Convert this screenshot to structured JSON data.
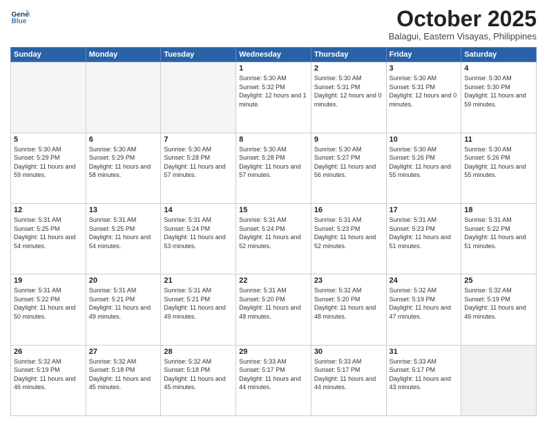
{
  "logo": {
    "line1": "General",
    "line2": "Blue"
  },
  "header": {
    "month": "October 2025",
    "location": "Balagui, Eastern Visayas, Philippines"
  },
  "weekdays": [
    "Sunday",
    "Monday",
    "Tuesday",
    "Wednesday",
    "Thursday",
    "Friday",
    "Saturday"
  ],
  "weeks": [
    [
      {
        "day": "",
        "sunrise": "",
        "sunset": "",
        "daylight": "",
        "empty": true
      },
      {
        "day": "",
        "sunrise": "",
        "sunset": "",
        "daylight": "",
        "empty": true
      },
      {
        "day": "",
        "sunrise": "",
        "sunset": "",
        "daylight": "",
        "empty": true
      },
      {
        "day": "1",
        "sunrise": "Sunrise: 5:30 AM",
        "sunset": "Sunset: 5:32 PM",
        "daylight": "Daylight: 12 hours and 1 minute."
      },
      {
        "day": "2",
        "sunrise": "Sunrise: 5:30 AM",
        "sunset": "Sunset: 5:31 PM",
        "daylight": "Daylight: 12 hours and 0 minutes."
      },
      {
        "day": "3",
        "sunrise": "Sunrise: 5:30 AM",
        "sunset": "Sunset: 5:31 PM",
        "daylight": "Daylight: 12 hours and 0 minutes."
      },
      {
        "day": "4",
        "sunrise": "Sunrise: 5:30 AM",
        "sunset": "Sunset: 5:30 PM",
        "daylight": "Daylight: 11 hours and 59 minutes."
      }
    ],
    [
      {
        "day": "5",
        "sunrise": "Sunrise: 5:30 AM",
        "sunset": "Sunset: 5:29 PM",
        "daylight": "Daylight: 11 hours and 59 minutes."
      },
      {
        "day": "6",
        "sunrise": "Sunrise: 5:30 AM",
        "sunset": "Sunset: 5:29 PM",
        "daylight": "Daylight: 11 hours and 58 minutes."
      },
      {
        "day": "7",
        "sunrise": "Sunrise: 5:30 AM",
        "sunset": "Sunset: 5:28 PM",
        "daylight": "Daylight: 11 hours and 57 minutes."
      },
      {
        "day": "8",
        "sunrise": "Sunrise: 5:30 AM",
        "sunset": "Sunset: 5:28 PM",
        "daylight": "Daylight: 11 hours and 57 minutes."
      },
      {
        "day": "9",
        "sunrise": "Sunrise: 5:30 AM",
        "sunset": "Sunset: 5:27 PM",
        "daylight": "Daylight: 11 hours and 56 minutes."
      },
      {
        "day": "10",
        "sunrise": "Sunrise: 5:30 AM",
        "sunset": "Sunset: 5:26 PM",
        "daylight": "Daylight: 11 hours and 55 minutes."
      },
      {
        "day": "11",
        "sunrise": "Sunrise: 5:30 AM",
        "sunset": "Sunset: 5:26 PM",
        "daylight": "Daylight: 11 hours and 55 minutes."
      }
    ],
    [
      {
        "day": "12",
        "sunrise": "Sunrise: 5:31 AM",
        "sunset": "Sunset: 5:25 PM",
        "daylight": "Daylight: 11 hours and 54 minutes."
      },
      {
        "day": "13",
        "sunrise": "Sunrise: 5:31 AM",
        "sunset": "Sunset: 5:25 PM",
        "daylight": "Daylight: 11 hours and 54 minutes."
      },
      {
        "day": "14",
        "sunrise": "Sunrise: 5:31 AM",
        "sunset": "Sunset: 5:24 PM",
        "daylight": "Daylight: 11 hours and 53 minutes."
      },
      {
        "day": "15",
        "sunrise": "Sunrise: 5:31 AM",
        "sunset": "Sunset: 5:24 PM",
        "daylight": "Daylight: 11 hours and 52 minutes."
      },
      {
        "day": "16",
        "sunrise": "Sunrise: 5:31 AM",
        "sunset": "Sunset: 5:23 PM",
        "daylight": "Daylight: 11 hours and 52 minutes."
      },
      {
        "day": "17",
        "sunrise": "Sunrise: 5:31 AM",
        "sunset": "Sunset: 5:23 PM",
        "daylight": "Daylight: 11 hours and 51 minutes."
      },
      {
        "day": "18",
        "sunrise": "Sunrise: 5:31 AM",
        "sunset": "Sunset: 5:22 PM",
        "daylight": "Daylight: 11 hours and 51 minutes."
      }
    ],
    [
      {
        "day": "19",
        "sunrise": "Sunrise: 5:31 AM",
        "sunset": "Sunset: 5:22 PM",
        "daylight": "Daylight: 11 hours and 50 minutes."
      },
      {
        "day": "20",
        "sunrise": "Sunrise: 5:31 AM",
        "sunset": "Sunset: 5:21 PM",
        "daylight": "Daylight: 11 hours and 49 minutes."
      },
      {
        "day": "21",
        "sunrise": "Sunrise: 5:31 AM",
        "sunset": "Sunset: 5:21 PM",
        "daylight": "Daylight: 11 hours and 49 minutes."
      },
      {
        "day": "22",
        "sunrise": "Sunrise: 5:31 AM",
        "sunset": "Sunset: 5:20 PM",
        "daylight": "Daylight: 11 hours and 48 minutes."
      },
      {
        "day": "23",
        "sunrise": "Sunrise: 5:32 AM",
        "sunset": "Sunset: 5:20 PM",
        "daylight": "Daylight: 11 hours and 48 minutes."
      },
      {
        "day": "24",
        "sunrise": "Sunrise: 5:32 AM",
        "sunset": "Sunset: 5:19 PM",
        "daylight": "Daylight: 11 hours and 47 minutes."
      },
      {
        "day": "25",
        "sunrise": "Sunrise: 5:32 AM",
        "sunset": "Sunset: 5:19 PM",
        "daylight": "Daylight: 11 hours and 46 minutes."
      }
    ],
    [
      {
        "day": "26",
        "sunrise": "Sunrise: 5:32 AM",
        "sunset": "Sunset: 5:19 PM",
        "daylight": "Daylight: 11 hours and 46 minutes."
      },
      {
        "day": "27",
        "sunrise": "Sunrise: 5:32 AM",
        "sunset": "Sunset: 5:18 PM",
        "daylight": "Daylight: 11 hours and 45 minutes."
      },
      {
        "day": "28",
        "sunrise": "Sunrise: 5:32 AM",
        "sunset": "Sunset: 5:18 PM",
        "daylight": "Daylight: 11 hours and 45 minutes."
      },
      {
        "day": "29",
        "sunrise": "Sunrise: 5:33 AM",
        "sunset": "Sunset: 5:17 PM",
        "daylight": "Daylight: 11 hours and 44 minutes."
      },
      {
        "day": "30",
        "sunrise": "Sunrise: 5:33 AM",
        "sunset": "Sunset: 5:17 PM",
        "daylight": "Daylight: 11 hours and 44 minutes."
      },
      {
        "day": "31",
        "sunrise": "Sunrise: 5:33 AM",
        "sunset": "Sunset: 5:17 PM",
        "daylight": "Daylight: 11 hours and 43 minutes."
      },
      {
        "day": "",
        "sunrise": "",
        "sunset": "",
        "daylight": "",
        "empty": true
      }
    ]
  ]
}
